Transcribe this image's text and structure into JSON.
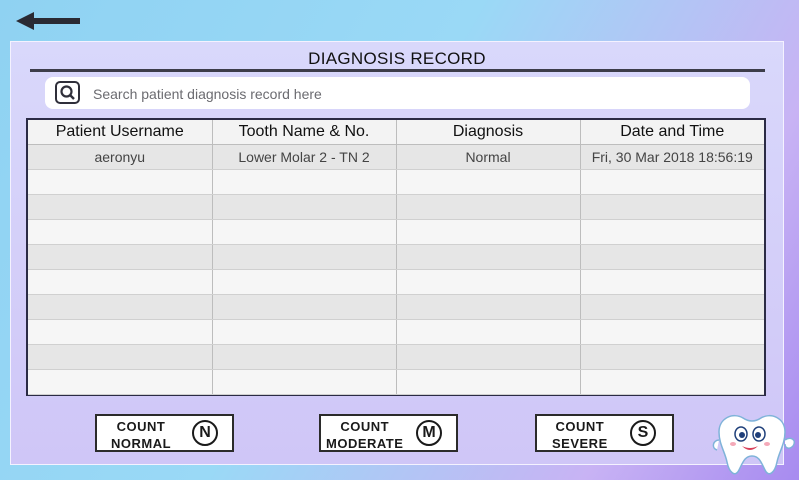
{
  "header": {
    "title": "DIAGNOSIS RECORD"
  },
  "search": {
    "placeholder": "Search patient diagnosis record here"
  },
  "table": {
    "columns": [
      "Patient Username",
      "Tooth Name & No.",
      "Diagnosis",
      "Date and Time"
    ],
    "rows": [
      [
        "aeronyu",
        "Lower Molar 2 - TN 2",
        "Normal",
        "Fri, 30 Mar 2018 18:56:19"
      ]
    ]
  },
  "buttons": {
    "normal": {
      "line1": "COUNT",
      "line2": "NORMAL",
      "badge": "N"
    },
    "moderate": {
      "line1": "COUNT",
      "line2": "MODERATE",
      "badge": "M"
    },
    "severe": {
      "line1": "COUNT",
      "line2": "SEVERE",
      "badge": "S"
    }
  },
  "icons": {
    "back": "back-arrow-icon",
    "search": "search-icon",
    "mascot": "tooth-mascot-icon"
  },
  "colors": {
    "table_border": "#2b2b45",
    "title_rule": "#3d3d4a"
  }
}
